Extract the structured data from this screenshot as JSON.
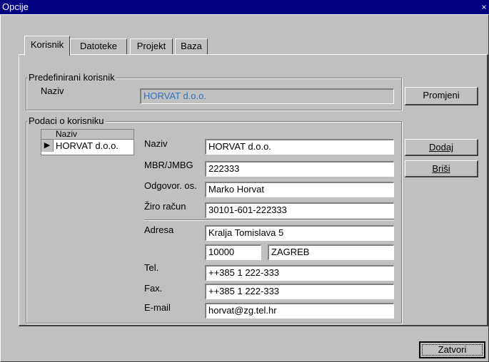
{
  "window": {
    "title": "Opcije",
    "close_glyph": "×"
  },
  "tabs": [
    {
      "label": "Korisnik"
    },
    {
      "label": "Datoteke"
    },
    {
      "label": "Projekt"
    },
    {
      "label": "Baza"
    }
  ],
  "predef": {
    "group_label": "Predefinirani korisnik",
    "name_label": "Naziv",
    "name_value": "HORVAT d.o.o.",
    "change_button": "Promjeni"
  },
  "details": {
    "group_label": "Podaci o korisniku",
    "grid": {
      "header": "Naziv",
      "rows": [
        "HORVAT d.o.o."
      ],
      "row_indicator": "▶"
    },
    "fields": {
      "naziv": {
        "label": "Naziv",
        "value": "HORVAT d.o.o."
      },
      "mbr": {
        "label": "MBR/JMBG",
        "value": "222333"
      },
      "odgovor": {
        "label": "Odgovor. os.",
        "value": "Marko Horvat"
      },
      "ziro": {
        "label": "Žiro račun",
        "value": "30101-601-222333"
      },
      "adresa": {
        "label": "Adresa",
        "value": "Kralja Tomislava 5"
      },
      "postcode": {
        "value": "10000"
      },
      "city": {
        "value": "ZAGREB"
      },
      "tel": {
        "label": "Tel.",
        "value": "++385 1 222-333"
      },
      "fax": {
        "label": "Fax.",
        "value": "++385 1 222-333"
      },
      "email": {
        "label": "E-mail",
        "value": "horvat@zg.tel.hr"
      }
    },
    "add_button": "Dodaj",
    "delete_button": "Briši"
  },
  "footer": {
    "close_button": "Zatvori"
  }
}
